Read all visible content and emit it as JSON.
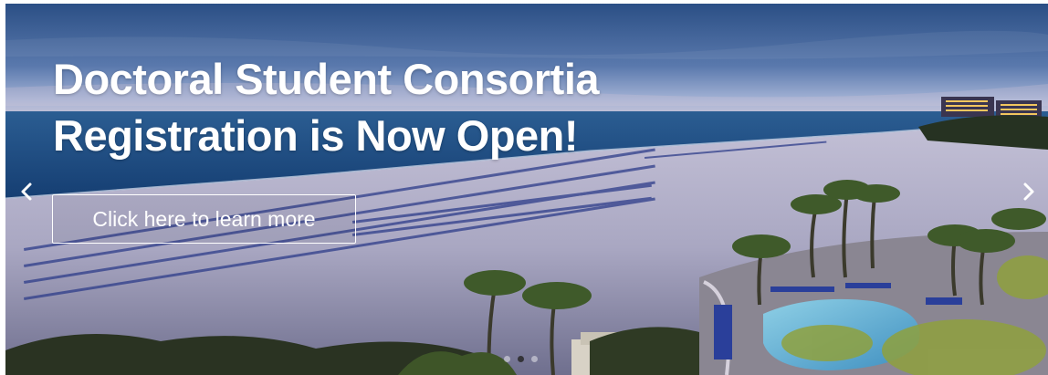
{
  "hero": {
    "headline_line1": "Doctoral Student Consortia",
    "headline_line2": "Registration is Now Open!",
    "cta_label": "Click here to learn more",
    "prev_icon": "chevron-left-icon",
    "next_icon": "chevron-right-icon",
    "slide_count": 3,
    "active_slide": 1
  },
  "colors": {
    "sky_top": "#274f86",
    "sky_horizon": "#b9c6de",
    "ocean": "#1c4d86",
    "sand": "#b3b1c9",
    "palm": "#2c3a22",
    "pool": "#6fb6d6",
    "text": "#ffffff"
  }
}
